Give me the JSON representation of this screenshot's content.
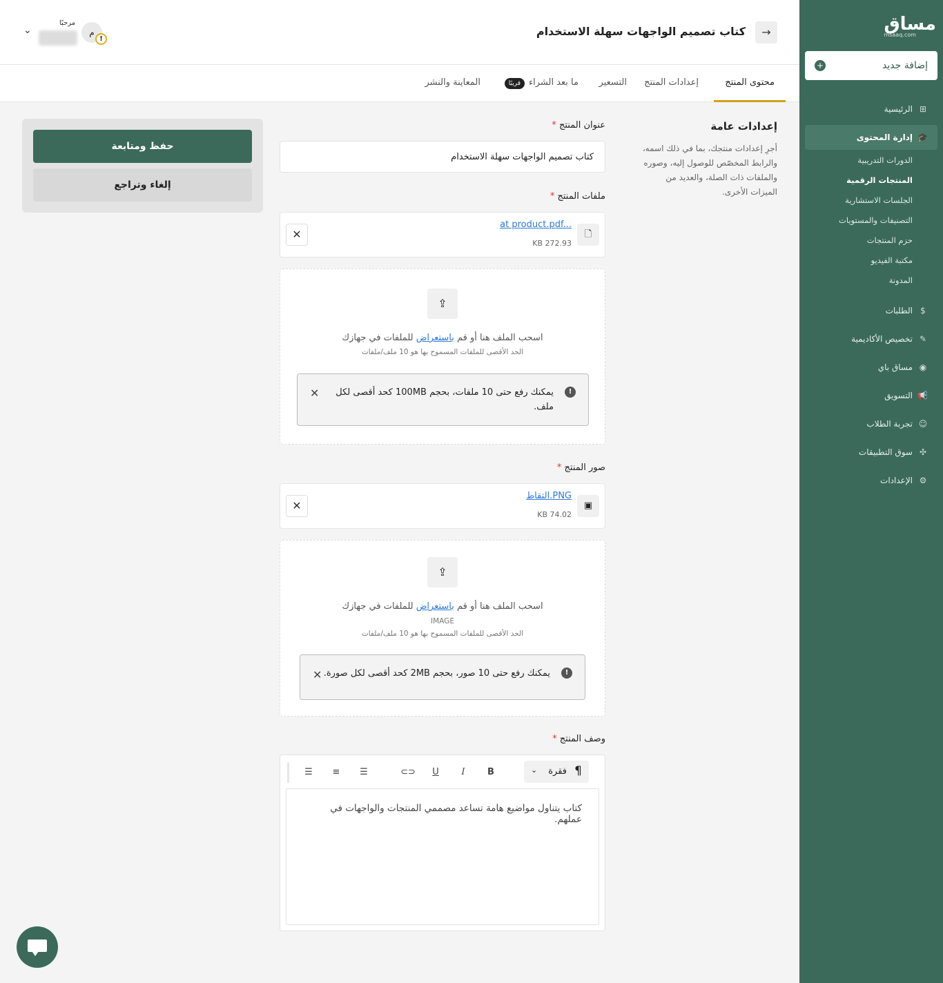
{
  "sidebar": {
    "logo": "مساق",
    "logo_sub": "msaaq.com",
    "add_new_label": "إضافة جديد",
    "items": [
      {
        "label": "الرئيسية",
        "icon": "grid-icon"
      },
      {
        "label": "إدارة المحتوى",
        "icon": "graduation-cap-icon"
      },
      {
        "label": "الطلبات",
        "icon": "dollar-icon"
      },
      {
        "label": "تخصيص الأكاديمية",
        "icon": "brush-icon"
      },
      {
        "label": "مساق باي",
        "icon": "pay-icon"
      },
      {
        "label": "التسويق",
        "icon": "megaphone-icon"
      },
      {
        "label": "تجربة الطلاب",
        "icon": "users-icon"
      },
      {
        "label": "سوق التطبيقات",
        "icon": "apps-icon"
      },
      {
        "label": "الإعدادات",
        "icon": "gear-icon"
      }
    ],
    "sub_items": [
      "الدورات التدريبية",
      "المنتجات الرقمية",
      "الجلسات الاستشارية",
      "التصنيفات والمستويات",
      "حزم المنتجات",
      "مكتبة الفيديو",
      "المدونة"
    ]
  },
  "header": {
    "title": "كتاب تصميم الواجهات سهلة الاستخدام",
    "greeting": "مرحبًا",
    "avatar_initial": "م",
    "warning_mark": "!"
  },
  "tabs": [
    {
      "label": "محتوى المنتج",
      "active": true
    },
    {
      "label": "إعدادات المنتج"
    },
    {
      "label": "التسعير"
    },
    {
      "label": "ما بعد الشراء",
      "badge": "قريبًا"
    },
    {
      "label": "المعاينة والنشر"
    }
  ],
  "general": {
    "title": "إعدادات عامة",
    "description": "أجرِ إعدادات منتجك، بما في ذلك اسمه، والرابط المخصّص للوصول إليه، وصوره والملفات ذات الصلة، والعديد من الميزات الأخرى."
  },
  "form": {
    "title_label": "عنوان المنتج",
    "required_mark": "*",
    "title_value": "كتاب تصميم الواجهات سهلة الاستخدام",
    "files_label": "ملفات المنتج",
    "file": {
      "name": "at product.pdf...",
      "size": "KB 272.93"
    },
    "dropzone_prefix": "اسحب الملف هنا أو قم",
    "dropzone_link": "باستعراض",
    "dropzone_suffix": "للملفات في جهازك",
    "max_files_note": "الحد الأقصى للملفات المسموح بها هو 10 ملف/ملفات",
    "files_alert": "يمكنك رفع حتى 10 ملفات، بحجم 100MB كحد أقصى لكل ملف.",
    "images_label": "صور المنتج",
    "image": {
      "name": "التقاط.PNG",
      "size": "KB 74.02"
    },
    "image_type_note": "IMAGE",
    "images_alert": "يمكنك رفع حتى 10 صور، بحجم 2MB كحد أقصى لكل صورة.",
    "alert_mark": "!",
    "description_label": "وصف المنتج",
    "paragraph_select": "فقرة",
    "description_value": "كتاب يتناول مواضيع هامة تساعد مصممي المنتجات والواجهات في عملهم."
  },
  "actions": {
    "save": "حفظ ومتابعة",
    "cancel": "إلغاء وتراجع"
  }
}
